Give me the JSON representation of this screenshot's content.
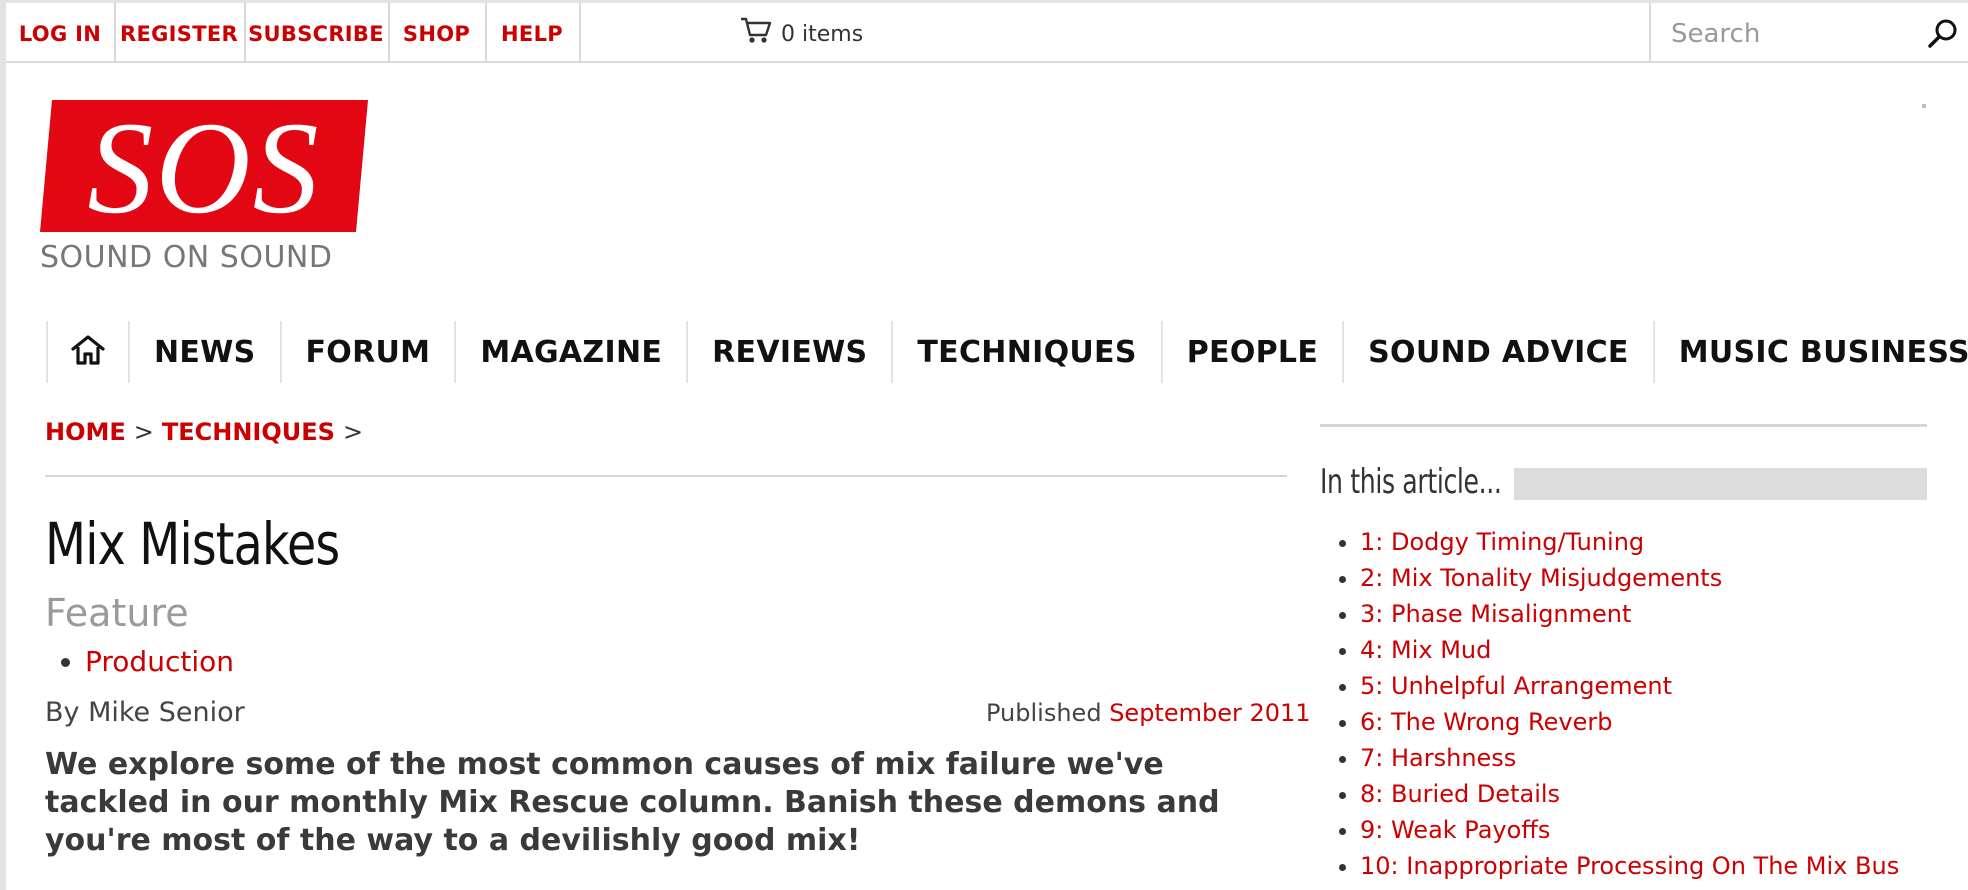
{
  "topbar": {
    "links": [
      "LOG IN",
      "REGISTER",
      "SUBSCRIBE",
      "SHOP",
      "HELP"
    ],
    "cart_label": "0 items",
    "search_placeholder": "Search"
  },
  "logo": {
    "letters": "SOS",
    "subtitle": "SOUND ON SOUND",
    "brand_color": "#e30613"
  },
  "nav": {
    "home_icon": "home-icon",
    "items": [
      "NEWS",
      "FORUM",
      "MAGAZINE",
      "REVIEWS",
      "TECHNIQUES",
      "PEOPLE",
      "SOUND ADVICE",
      "MUSIC BUSINESS"
    ]
  },
  "breadcrumb": {
    "home": "HOME",
    "section": "TECHNIQUES",
    "separator": ">"
  },
  "article": {
    "title": "Mix Mistakes",
    "kind": "Feature",
    "tags": [
      "Production"
    ],
    "byline": "By Mike Senior",
    "published_label": "Published",
    "published_date": "September 2011",
    "lead": "We explore some of the most common causes of mix failure we've tackled in our monthly Mix Rescue column. Banish these demons and you're most of the way to a devilishly good mix!"
  },
  "sidebar": {
    "title": "In this article...",
    "items": [
      "1: Dodgy Timing/Tuning",
      "2: Mix Tonality Misjudgements",
      "3: Phase Misalignment",
      "4: Mix Mud",
      "5: Unhelpful Arrangement",
      "6: The Wrong Reverb",
      "7: Harshness",
      "8: Buried Details",
      "9: Weak Payoffs",
      "10: Inappropriate Processing On The Mix Bus"
    ]
  },
  "colors": {
    "accent": "#cc0000",
    "text": "#333333",
    "muted": "#9a9a9a"
  }
}
